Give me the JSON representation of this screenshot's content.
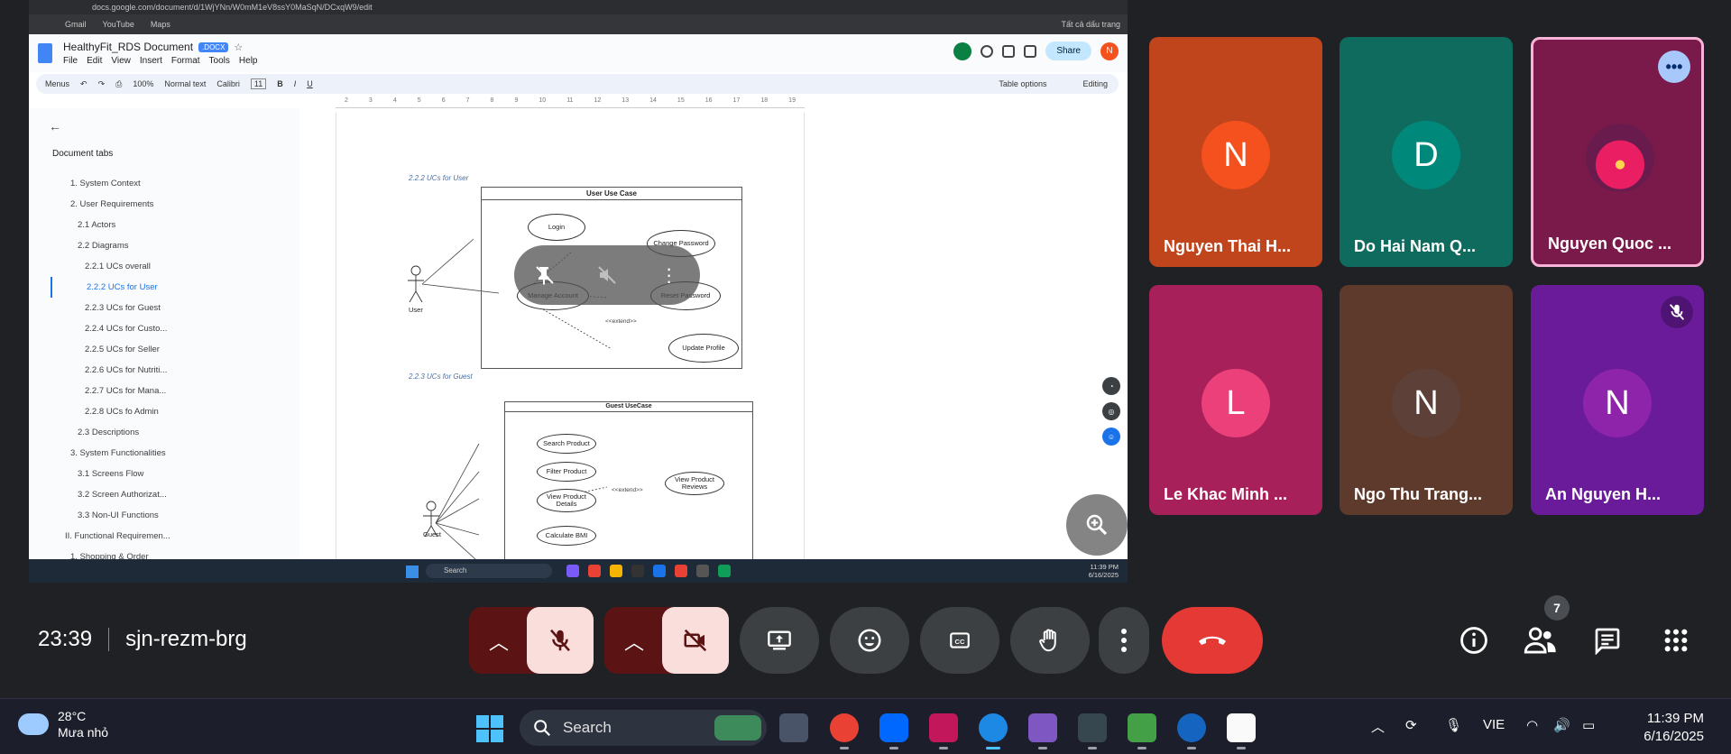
{
  "shared_screen": {
    "url": "docs.google.com/document/d/1WjYNn/W0mM1eV8ssY0MaSqN/DCxqW9/edit",
    "bookmarks": [
      "Gmail",
      "YouTube",
      "Maps"
    ],
    "bookmarks_right": "Tất cả dấu trang",
    "doc_title": "HealthyFit_RDS Document",
    "doc_badge": ".DOCX",
    "menus": [
      "File",
      "Edit",
      "View",
      "Insert",
      "Format",
      "Tools",
      "Help"
    ],
    "share_label": "Share",
    "user_initial": "N",
    "toolbar": {
      "menus": "Menus",
      "zoom": "100%",
      "style": "Normal text",
      "font": "Calibri",
      "size": "11",
      "table_options": "Table options",
      "mode": "Editing"
    },
    "ruler_marks": [
      "2",
      "3",
      "4",
      "5",
      "6",
      "7",
      "8",
      "9",
      "10",
      "11",
      "12",
      "13",
      "14",
      "15",
      "16",
      "17",
      "18",
      "19"
    ],
    "sidebar": {
      "title": "Document tabs",
      "outline": [
        {
          "label": "1. System Context",
          "level": "lvl1"
        },
        {
          "label": "2. User Requirements",
          "level": "lvl1"
        },
        {
          "label": "2.1 Actors",
          "level": "lvl2"
        },
        {
          "label": "2.2 Diagrams",
          "level": "lvl2"
        },
        {
          "label": "2.2.1 UCs overall",
          "level": "lvl3"
        },
        {
          "label": "2.2.2 UCs for User",
          "level": "lvl3",
          "active": true
        },
        {
          "label": "2.2.3 UCs for Guest",
          "level": "lvl3"
        },
        {
          "label": "2.2.4 UCs for Custo...",
          "level": "lvl3"
        },
        {
          "label": "2.2.5 UCs for Seller",
          "level": "lvl3"
        },
        {
          "label": "2.2.6 UCs for Nutriti...",
          "level": "lvl3"
        },
        {
          "label": "2.2.7 UCs for Mana...",
          "level": "lvl3"
        },
        {
          "label": "2.2.8 UCs fo Admin",
          "level": "lvl3"
        },
        {
          "label": "2.3 Descriptions",
          "level": "lvl2"
        },
        {
          "label": "3. System Functionalities",
          "level": "lvl1"
        },
        {
          "label": "3.1 Screens Flow",
          "level": "lvl2"
        },
        {
          "label": "3.2 Screen Authorizat...",
          "level": "lvl2"
        },
        {
          "label": "3.3 Non-UI Functions",
          "level": "lvl2"
        },
        {
          "label": "II. Functional Requiremen...",
          "level": "lvl0"
        },
        {
          "label": "1. Shopping & Order",
          "level": "lvl1"
        }
      ]
    },
    "doc": {
      "caption_user": "2.2.2 UCs for User",
      "user_diagram_title": "User Use Case",
      "user_actor": "User",
      "user_ucs": [
        "Login",
        "Change Password",
        "Manage Account",
        "Reset Password",
        "Update Profile"
      ],
      "extend": "<<extend>>",
      "caption_guest": "2.2.3 UCs for Guest",
      "guest_diagram_title": "Guest UseCase",
      "guest_actor": "Guest",
      "guest_ucs": [
        "Search Product",
        "Filter Product",
        "View Product Details",
        "Calculate BMI",
        "View Product Reviews"
      ]
    },
    "inner_taskbar": {
      "search": "Search",
      "time": "11:39 PM",
      "date": "6/16/2025"
    }
  },
  "participants": [
    {
      "name": "Nguyen Thai H...",
      "initial": "N",
      "bg": "#c0451d",
      "avatar": "#f4511e"
    },
    {
      "name": "Do Hai Nam Q...",
      "initial": "D",
      "bg": "#0f6b5d",
      "avatar": "#00897b"
    },
    {
      "name": "Nguyen Quoc ...",
      "initial": "",
      "bg": "#7a1a4a",
      "avatar": "#b0305a"
    },
    {
      "name": "Le Khac Minh ...",
      "initial": "L",
      "bg": "#a8205a",
      "avatar": "#ec407a"
    },
    {
      "name": "Ngo Thu Trang...",
      "initial": "N",
      "bg": "#5d3a2c",
      "avatar": "#5d4037"
    },
    {
      "name": "An Nguyen H...",
      "initial": "N",
      "bg": "#6a1b9a",
      "avatar": "#8e24aa"
    }
  ],
  "meeting": {
    "time": "23:39",
    "code": "sjn-rezm-brg",
    "people_count": "7"
  },
  "taskbar": {
    "temp": "28°C",
    "weather": "Mưa nhỏ",
    "search": "Search",
    "lang": "VIE",
    "time": "11:39 PM",
    "date": "6/16/2025"
  }
}
